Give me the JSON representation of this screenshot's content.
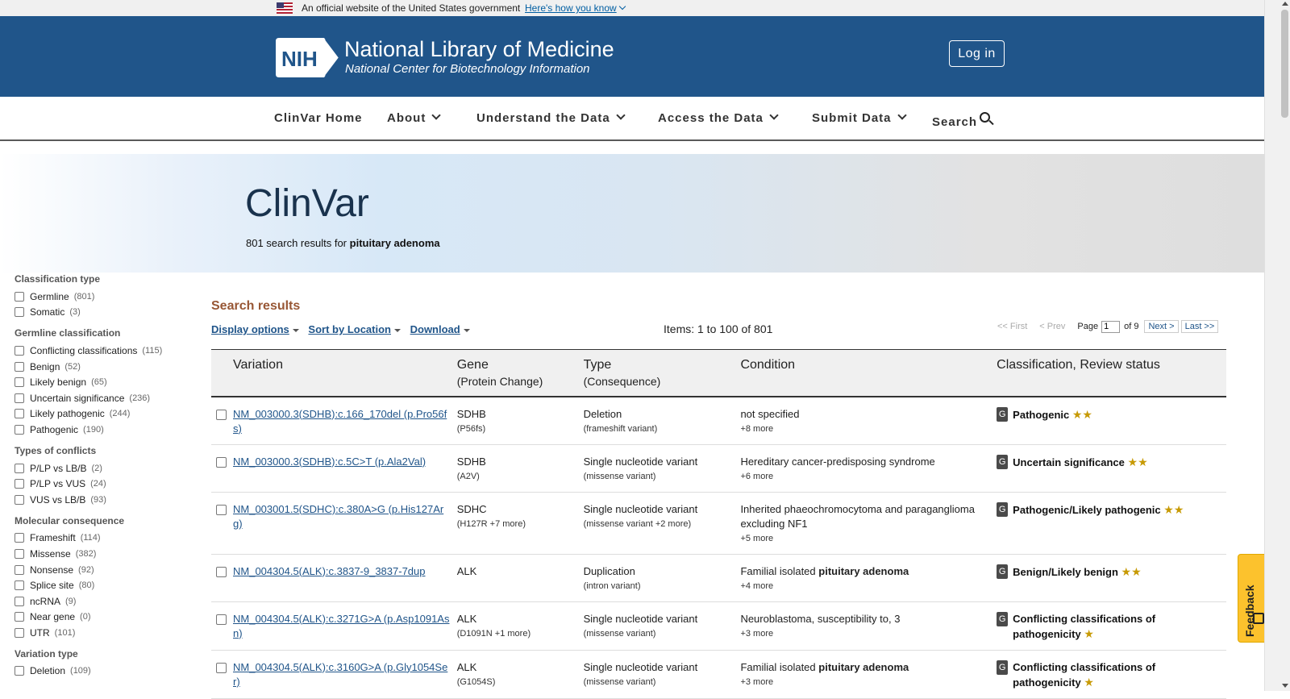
{
  "gov_banner": {
    "official_text": "An official website of the United States government",
    "how_link": "Here's how you know"
  },
  "header": {
    "logo_text": "NIH",
    "title": "National Library of Medicine",
    "subtitle": "National Center for Biotechnology Information",
    "login": "Log in",
    "brand_color": "#20558a"
  },
  "nav": {
    "items": [
      {
        "label": "ClinVar Home",
        "icon": ""
      },
      {
        "label": "About",
        "icon": "chevron-down-icon"
      },
      {
        "label": "Understand the Data",
        "icon": "chevron-down-icon"
      },
      {
        "label": "Access the Data",
        "icon": "chevron-down-icon"
      },
      {
        "label": "Submit Data",
        "icon": "chevron-down-icon"
      },
      {
        "label": "Search",
        "icon": "search-icon"
      }
    ]
  },
  "hero": {
    "title": "ClinVar",
    "results_prefix": "801 search results for",
    "query": "pituitary adenoma"
  },
  "sidebar": {
    "groups": [
      {
        "title": "Classification type",
        "facets": [
          {
            "label": "Germline",
            "count": "(801)"
          },
          {
            "label": "Somatic",
            "count": "(3)"
          }
        ]
      },
      {
        "title": "Germline classification",
        "facets": [
          {
            "label": "Conflicting classifications",
            "count": "(115)"
          },
          {
            "label": "Benign",
            "count": "(52)"
          },
          {
            "label": "Likely benign",
            "count": "(65)"
          },
          {
            "label": "Uncertain significance",
            "count": "(236)"
          },
          {
            "label": "Likely pathogenic",
            "count": "(244)"
          },
          {
            "label": "Pathogenic",
            "count": "(190)"
          }
        ]
      },
      {
        "title": "Types of conflicts",
        "facets": [
          {
            "label": "P/LP vs LB/B",
            "count": "(2)"
          },
          {
            "label": "P/LP vs VUS",
            "count": "(24)"
          },
          {
            "label": "VUS vs LB/B",
            "count": "(93)"
          }
        ]
      },
      {
        "title": "Molecular consequence",
        "facets": [
          {
            "label": "Frameshift",
            "count": "(114)"
          },
          {
            "label": "Missense",
            "count": "(382)"
          },
          {
            "label": "Nonsense",
            "count": "(92)"
          },
          {
            "label": "Splice site",
            "count": "(80)"
          },
          {
            "label": "ncRNA",
            "count": "(9)"
          },
          {
            "label": "Near gene",
            "count": "(0)"
          },
          {
            "label": "UTR",
            "count": "(101)"
          }
        ]
      },
      {
        "title": "Variation type",
        "facets": [
          {
            "label": "Deletion",
            "count": "(109)"
          }
        ]
      }
    ]
  },
  "results": {
    "heading": "Search results",
    "heading_color": "#985735",
    "tools": {
      "display": "Display options",
      "sort": "Sort by Location",
      "download": "Download"
    },
    "items_count": "Items: 1 to 100 of 801",
    "pager": {
      "first": "<< First",
      "prev": "< Prev",
      "page_label": "Page",
      "page_value": "1",
      "of": "of 9",
      "next": "Next >",
      "last": "Last >>"
    },
    "columns": {
      "variation": "Variation",
      "gene": "Gene",
      "gene_sub": "(Protein Change)",
      "type": "Type",
      "type_sub": "(Consequence)",
      "condition": "Condition",
      "classification": "Classification, Review status"
    },
    "rows": [
      {
        "variation": "NM_003000.3(SDHB):c.166_170del (p.Pro56fs)",
        "gene": "SDHB",
        "protein": "(P56fs)",
        "type": "Deletion",
        "consequence": "(frameshift variant)",
        "condition_text": "not specified",
        "condition_bold": "",
        "condition_more": "+8 more",
        "badge": "G",
        "classification": "Pathogenic",
        "stars": "★★"
      },
      {
        "variation": "NM_003000.3(SDHB):c.5C>T (p.Ala2Val)",
        "gene": "SDHB",
        "protein": "(A2V)",
        "type": "Single nucleotide variant",
        "consequence": "(missense variant)",
        "condition_text": "Hereditary cancer-predisposing syndrome",
        "condition_bold": "",
        "condition_more": "+6 more",
        "badge": "G",
        "classification": "Uncertain significance",
        "stars": "★★"
      },
      {
        "variation": "NM_003001.5(SDHC):c.380A>G (p.His127Arg)",
        "gene": "SDHC",
        "protein": "(H127R +7 more)",
        "type": "Single nucleotide variant",
        "consequence": "(missense variant +2 more)",
        "condition_text": "Inherited phaeochromocytoma and paraganglioma excluding NF1",
        "condition_bold": "",
        "condition_more": "+5 more",
        "badge": "G",
        "classification": "Pathogenic/Likely pathogenic",
        "stars": "★★"
      },
      {
        "variation": "NM_004304.5(ALK):c.3837-9_3837-7dup",
        "gene": "ALK",
        "protein": "",
        "type": "Duplication",
        "consequence": "(intron variant)",
        "condition_text": "Familial isolated",
        "condition_bold": "pituitary adenoma",
        "condition_more": "+4 more",
        "badge": "G",
        "classification": "Benign/Likely benign",
        "stars": "★★"
      },
      {
        "variation": "NM_004304.5(ALK):c.3271G>A (p.Asp1091Asn)",
        "gene": "ALK",
        "protein": "(D1091N +1 more)",
        "type": "Single nucleotide variant",
        "consequence": "(missense variant)",
        "condition_text": "Neuroblastoma, susceptibility to, 3",
        "condition_bold": "",
        "condition_more": "+3 more",
        "badge": "G",
        "classification": "Conflicting classifications of pathogenicity",
        "stars": "★"
      },
      {
        "variation": "NM_004304.5(ALK):c.3160G>A (p.Gly1054Ser)",
        "gene": "ALK",
        "protein": "(G1054S)",
        "type": "Single nucleotide variant",
        "consequence": "(missense variant)",
        "condition_text": "Familial isolated",
        "condition_bold": "pituitary adenoma",
        "condition_more": "+3 more",
        "badge": "G",
        "classification": "Conflicting classifications of pathogenicity",
        "stars": "★"
      }
    ]
  },
  "feedback": {
    "label": "Feedback"
  }
}
